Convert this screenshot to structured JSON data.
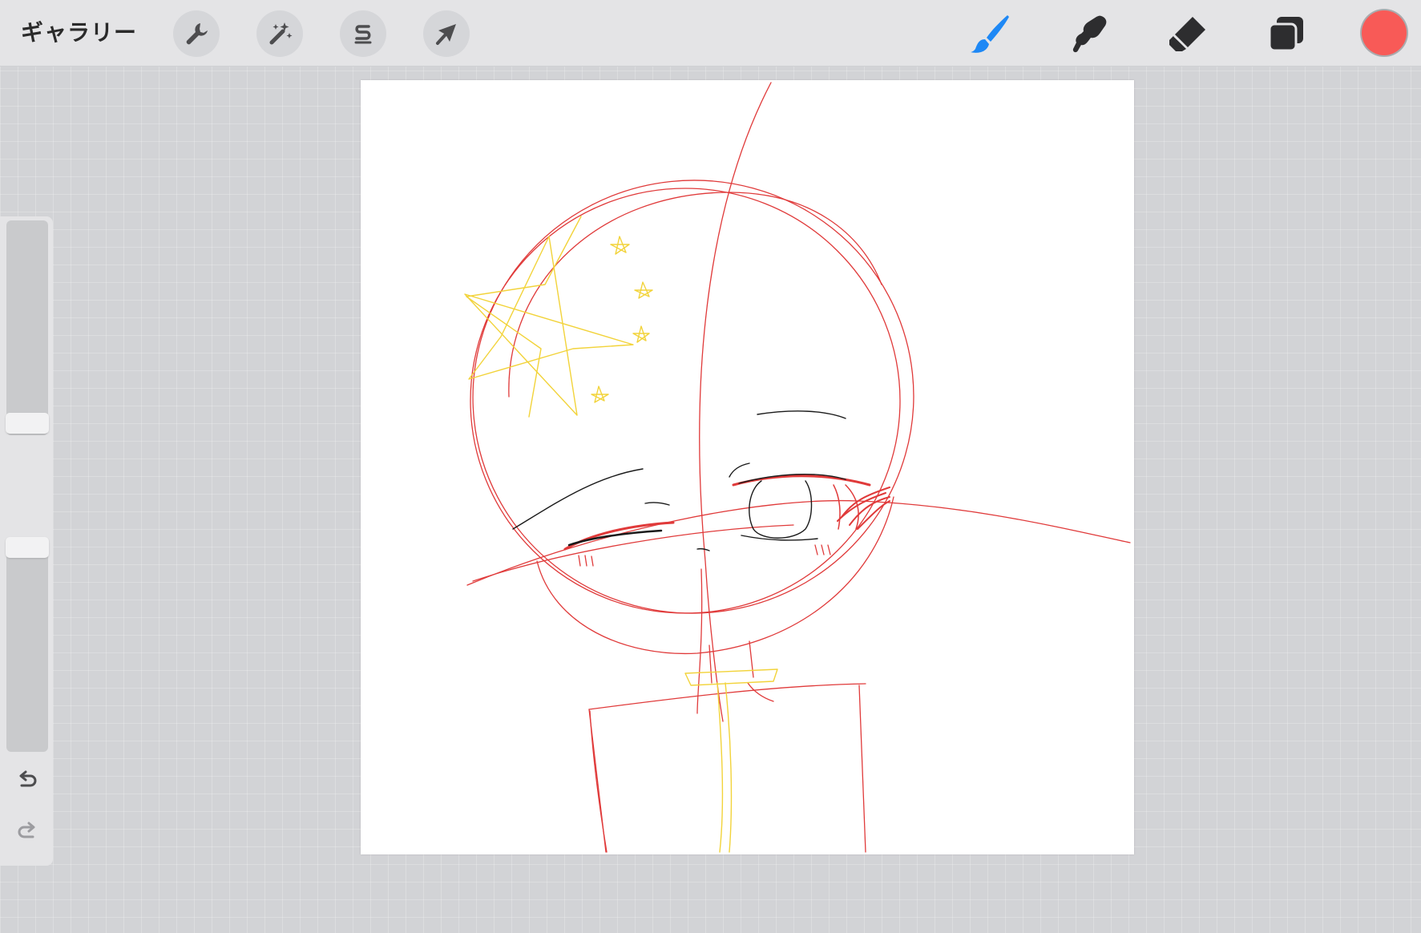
{
  "app": {
    "gallery_label": "ギャラリー"
  },
  "toolbar": {
    "left_tools": [
      "wrench-icon",
      "magic-wand-icon",
      "selection-icon",
      "transform-arrow-icon"
    ],
    "right_tools": [
      "brush-icon",
      "smudge-icon",
      "eraser-icon",
      "layers-icon"
    ],
    "active_tool": "brush",
    "active_color": "#f85a57",
    "accent_color": "#1e88f5"
  },
  "sidebar": {
    "brush_size_level": 0.37,
    "opacity_level": 0.96,
    "undo_icon": "undo-icon",
    "redo_icon": "redo-icon"
  }
}
